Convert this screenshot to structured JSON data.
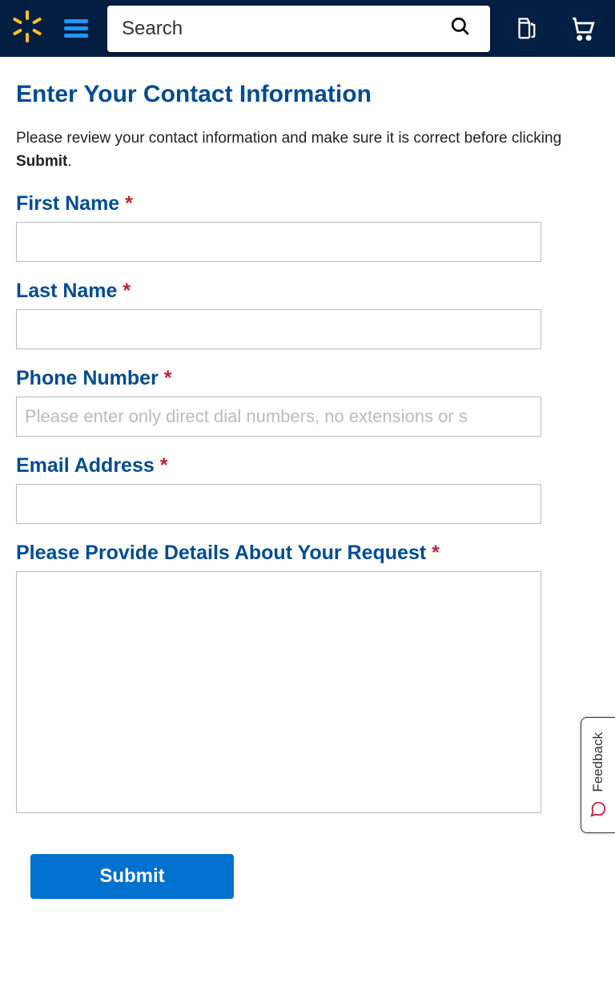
{
  "header": {
    "search_placeholder": "Search"
  },
  "page": {
    "title": "Enter Your Contact Information",
    "intro_text": "Please review your contact information and make sure it is correct before clicking ",
    "intro_strong": "Submit",
    "intro_period": "."
  },
  "fields": {
    "first_name": {
      "label": "First Name "
    },
    "last_name": {
      "label": "Last Name "
    },
    "phone": {
      "label": "Phone Number ",
      "placeholder": "Please enter only direct dial numbers, no extensions or s"
    },
    "email": {
      "label": "Email Address "
    },
    "details": {
      "label": "Please Provide Details About Your Request "
    }
  },
  "required_marker": "*",
  "submit_label": "Submit",
  "feedback_label": "Feedback"
}
